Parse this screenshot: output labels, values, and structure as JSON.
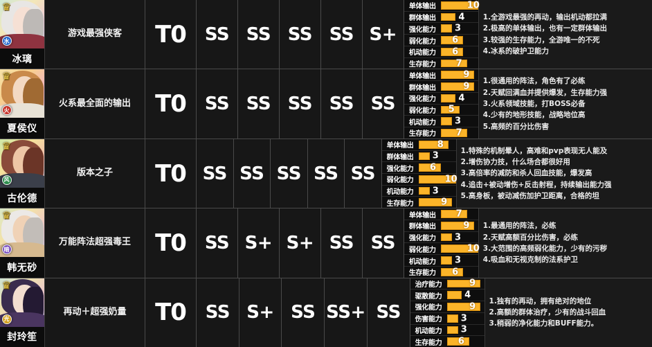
{
  "table": {
    "stat_max": 10,
    "accent_color": "#fbb429",
    "background_color": "#121212",
    "rows": [
      {
        "character": {
          "name": "冰璃",
          "rank_icon": "crown-icon",
          "element_icon": "water-element-icon",
          "element_glyph": "水",
          "element_color": "#2f6fd0",
          "hair_color": "#e8e6e4",
          "hair_shadow": "#bdb9b6",
          "skin_color": "#f6e0d4",
          "body_color": "#8f3340",
          "bg_gradient": "linear-gradient(135deg,#cfe9d8 0%,#f3e7b8 38%,#f0c9d8 70%,#cfd8f0 100%)"
        },
        "desc": "游戏最强侠客",
        "tier": "T0",
        "grades": [
          "SS",
          "SS",
          "SS",
          "SS",
          "S+"
        ],
        "stats": [
          {
            "label": "单体输出",
            "value": 10
          },
          {
            "label": "群体输出",
            "value": 4
          },
          {
            "label": "强化能力",
            "value": 3
          },
          {
            "label": "弱化能力",
            "value": 6
          },
          {
            "label": "机动能力",
            "value": 6
          },
          {
            "label": "生存能力",
            "value": 7
          }
        ],
        "notes": [
          "1.全游戏最强的再动，输出机动都拉满",
          "2.极高的单体输出，也有一定群体输出",
          "3.较强的生存能力，全游唯一的不死",
          "4.冰系的破护卫能力"
        ]
      },
      {
        "character": {
          "name": "夏侯仪",
          "rank_icon": "crown-icon",
          "element_icon": "fire-element-icon",
          "element_glyph": "火",
          "element_color": "#c8352c",
          "hair_color": "#c98a4b",
          "hair_shadow": "#a06a33",
          "skin_color": "#f3d9c3",
          "body_color": "#e8e2d6",
          "bg_gradient": "linear-gradient(135deg,#f6e3a8 0%,#f7cf8e 35%,#f3b6c6 68%,#d8c9ec 100%)"
        },
        "desc": "火系最全面的输出",
        "tier": "T0",
        "grades": [
          "SS",
          "SS",
          "SS",
          "SS",
          "SS"
        ],
        "stats": [
          {
            "label": "单体输出",
            "value": 9
          },
          {
            "label": "群体输出",
            "value": 9
          },
          {
            "label": "强化能力",
            "value": 4
          },
          {
            "label": "弱化能力",
            "value": 5
          },
          {
            "label": "机动能力",
            "value": 3
          },
          {
            "label": "生存能力",
            "value": 7
          }
        ],
        "notes": [
          "1.很通用的阵法，角色有了必练",
          "2.天赋回满血并提供爆发，生存能力强",
          "3.火系领域技能，打BOSS必备",
          "4.少有的地形技能，战略地位高",
          "5.高频的百分比伤害"
        ]
      },
      {
        "character": {
          "name": "古伦德",
          "rank_icon": "crown-icon",
          "element_icon": "wind-element-icon",
          "element_glyph": "风",
          "element_color": "#2f8f4f",
          "hair_color": "#8a4b3a",
          "hair_shadow": "#6b3527",
          "skin_color": "#edc6a6",
          "body_color": "#3b3f4a",
          "bg_gradient": "linear-gradient(135deg,#cfe9a8 0%,#f4e39a 35%,#f3bdb0 68%,#c8d6ee 100%)"
        },
        "desc": "版本之子",
        "tier": "T0",
        "grades": [
          "SS",
          "SS",
          "SS",
          "SS",
          "SS"
        ],
        "stats": [
          {
            "label": "单体输出",
            "value": 8
          },
          {
            "label": "群体输出",
            "value": 3
          },
          {
            "label": "强化能力",
            "value": 6
          },
          {
            "label": "弱化能力",
            "value": 10
          },
          {
            "label": "机动能力",
            "value": 3
          },
          {
            "label": "生存能力",
            "value": 9
          }
        ],
        "notes": [
          "1.特殊的机制晕人，高难和pvp表现无人能及",
          "2.增伤协力技，什么场合都很好用",
          "3.高倍率的减防和杀人回血技能，爆发高",
          "4.追击+被动增伤+反击射程，持续输出能力强",
          "5.高身板，被动减伤加护卫距离，合格的坦"
        ]
      },
      {
        "character": {
          "name": "韩无砂",
          "rank_icon": "crown-gold-icon",
          "element_icon": "dark-element-icon",
          "element_glyph": "暗",
          "element_color": "#7b4fc0",
          "hair_color": "#ece9e6",
          "hair_shadow": "#c2bdb8",
          "skin_color": "#f0d2b6",
          "body_color": "#d6b98f",
          "bg_gradient": "linear-gradient(135deg,#d9e8c8 0%,#f2e2a8 35%,#f0c3c8 68%,#cdc8ec 100%)"
        },
        "desc": "万能阵法超强毒王",
        "tier": "T0",
        "grades": [
          "SS",
          "S+",
          "S+",
          "SS",
          "SS"
        ],
        "stats": [
          {
            "label": "单体输出",
            "value": 7
          },
          {
            "label": "群体输出",
            "value": 9
          },
          {
            "label": "强化能力",
            "value": 3
          },
          {
            "label": "弱化能力",
            "value": 10
          },
          {
            "label": "机动能力",
            "value": 3
          },
          {
            "label": "生存能力",
            "value": 6
          }
        ],
        "notes": [
          "1.最通用的阵法，必练",
          "2.天赋高额百分比伤害，必练",
          "3.大范围的高频弱化能力，少有的污秽",
          "4.吸血和无视克制的法系护卫"
        ]
      },
      {
        "character": {
          "name": "封玲笙",
          "rank_icon": "crown-icon",
          "element_icon": "light-element-icon",
          "element_glyph": "光",
          "element_color": "#d4a01e",
          "hair_color": "#3a2c4e",
          "hair_shadow": "#241a33",
          "skin_color": "#f3ded0",
          "body_color": "#4a3560",
          "bg_gradient": "linear-gradient(135deg,#cfe4d4 0%,#efe0b0 35%,#e9c0cf 68%,#c6c6e8 100%)"
        },
        "desc": "再动＋超强奶量",
        "tier": "T0",
        "grades": [
          "SS",
          "S+",
          "SS",
          "SS+",
          "SS"
        ],
        "stats": [
          {
            "label": "治疗能力",
            "value": 9
          },
          {
            "label": "驱散能力",
            "value": 4
          },
          {
            "label": "强化能力",
            "value": 9
          },
          {
            "label": "伤害能力",
            "value": 3
          },
          {
            "label": "机动能力",
            "value": 3
          },
          {
            "label": "生存能力",
            "value": 6
          }
        ],
        "notes": [
          "1.独有的再动，拥有绝对的地位",
          "2.高额的群体治疗，少有的战斗回血",
          "3.稍弱的净化能力和BUFF能力。"
        ]
      }
    ]
  }
}
